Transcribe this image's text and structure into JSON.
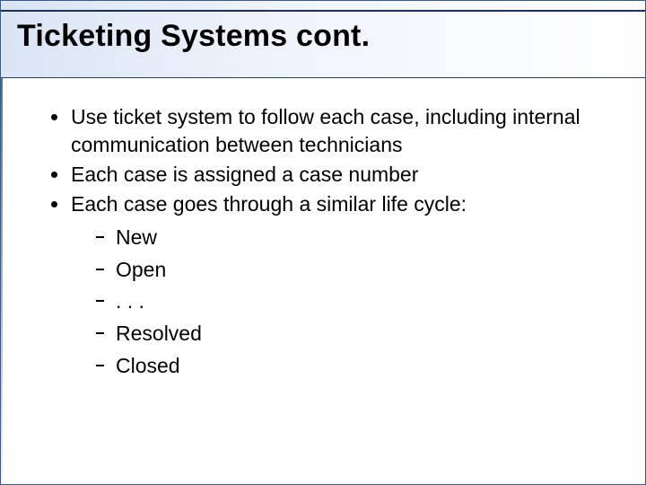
{
  "title": "Ticketing Systems cont.",
  "bullets": {
    "b1": "Use ticket system to follow each case, including internal communication between technicians",
    "b2": "Each case is assigned a case number",
    "b3": "Each case goes through a similar life cycle:"
  },
  "lifecycle": {
    "s1": "New",
    "s2": "Open",
    "s3": ". . .",
    "s4": "Resolved",
    "s5": "Closed"
  }
}
